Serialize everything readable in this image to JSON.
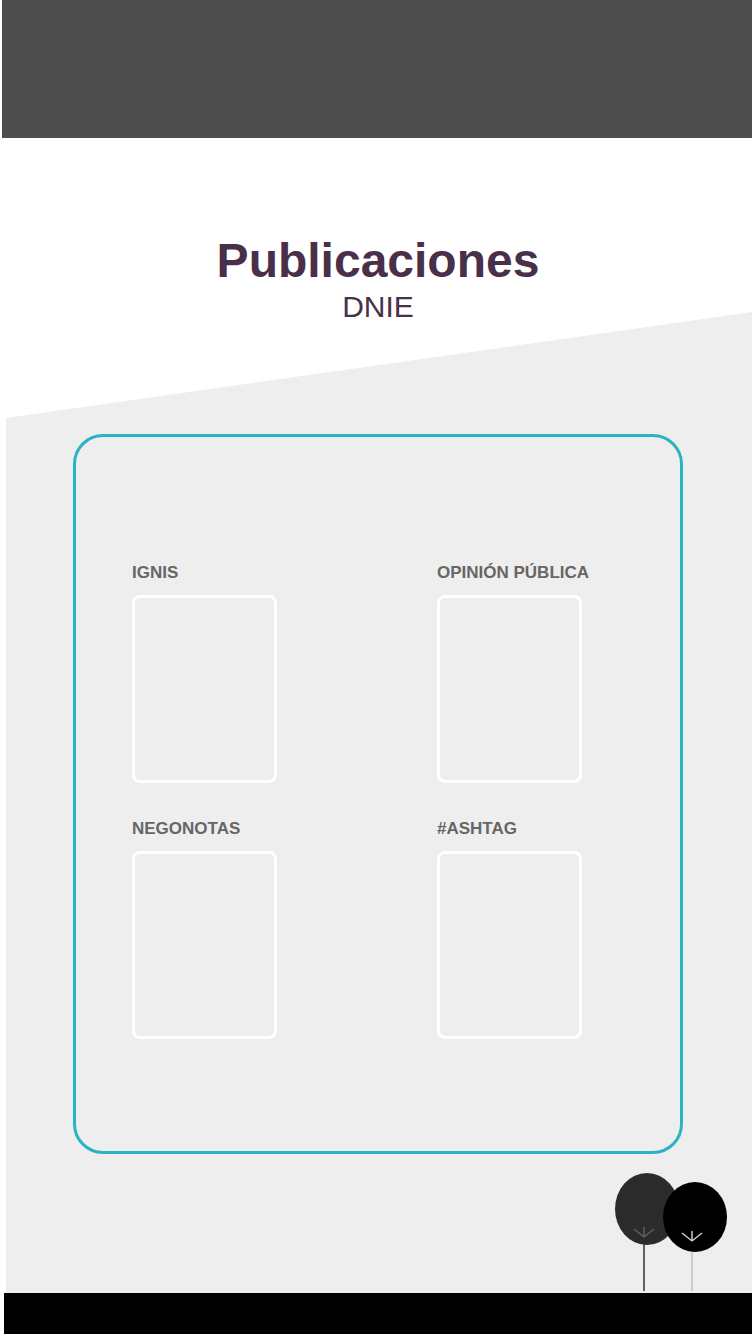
{
  "header": {
    "title": "Publicaciones",
    "subtitle": "DNIE"
  },
  "publications": [
    {
      "label": "IGNIS"
    },
    {
      "label": "OPINIÓN PÚBLICA"
    },
    {
      "label": "NEGONOTAS"
    },
    {
      "label": "#ASHTAG"
    }
  ]
}
